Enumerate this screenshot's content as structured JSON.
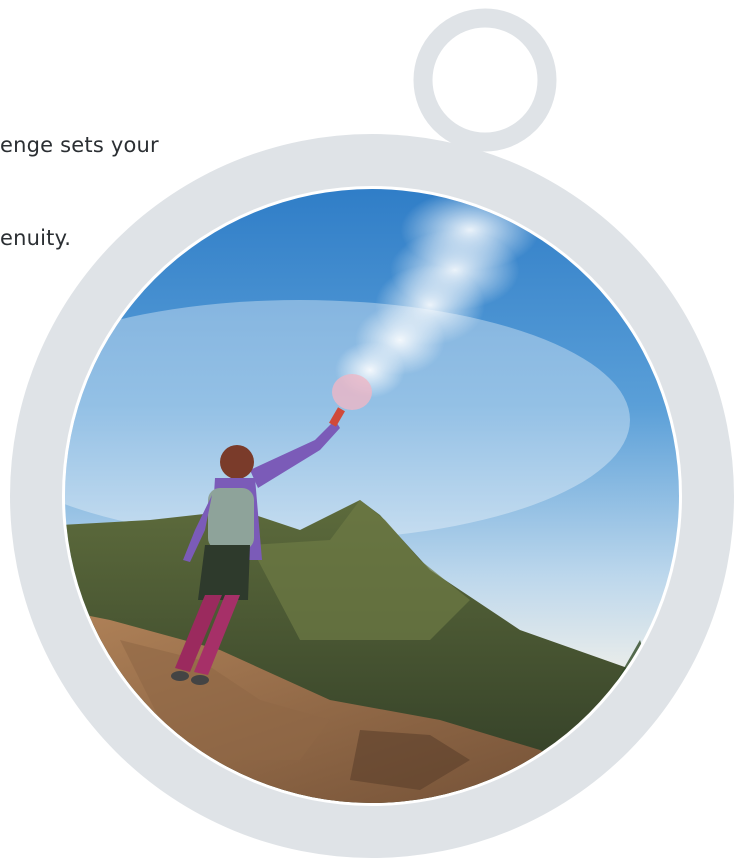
{
  "intro": {
    "line1": "enge sets your",
    "line2": "enuity."
  },
  "medallion": {
    "ring_color": "#dfe3e7",
    "photo_alt": "hiker raising a smoking flare on a rocky mountain ridge"
  }
}
